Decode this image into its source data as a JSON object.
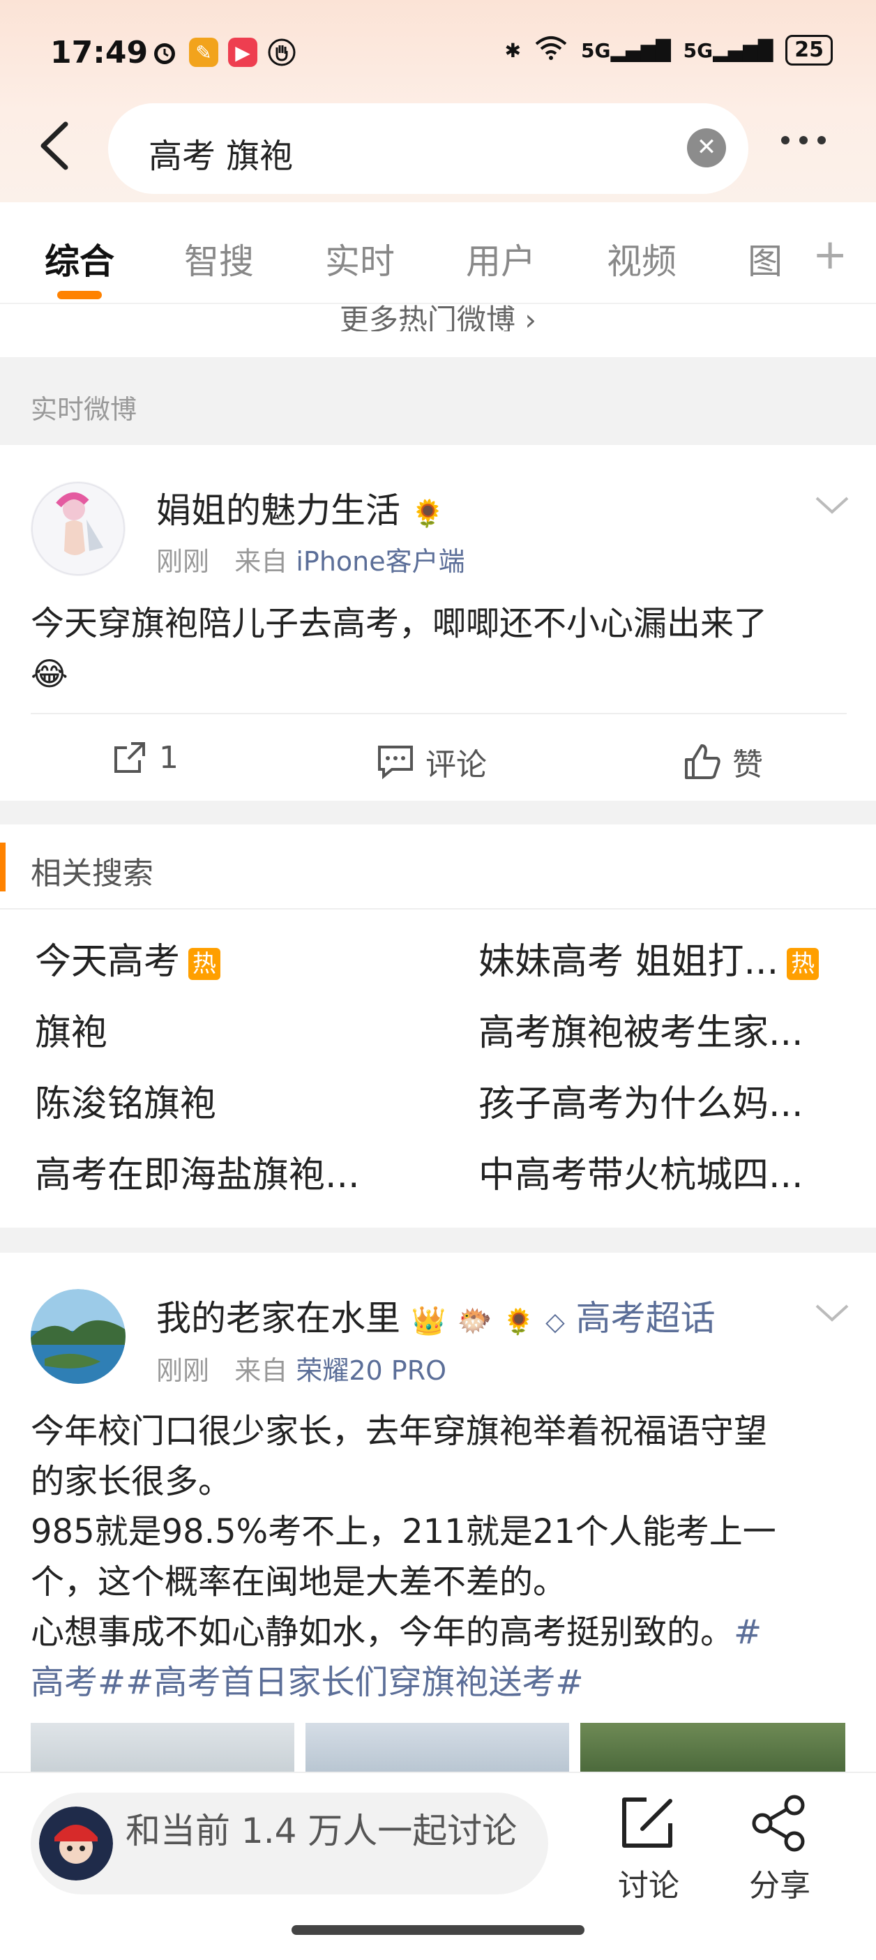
{
  "status_bar": {
    "time": "17:49",
    "network1": "5G",
    "network2": "5G",
    "battery": "25"
  },
  "search": {
    "query": "高考 旗袍"
  },
  "tabs": [
    {
      "label": "综合",
      "active": true
    },
    {
      "label": "智搜",
      "active": false
    },
    {
      "label": "实时",
      "active": false
    },
    {
      "label": "用户",
      "active": false
    },
    {
      "label": "视频",
      "active": false
    },
    {
      "label": "图",
      "active": false
    }
  ],
  "more_hot": "更多热门微博 ›",
  "section_realtime": "实时微博",
  "post1": {
    "username": "娟姐的魅力生活",
    "time": "刚刚",
    "from_label": "来自",
    "source": "iPhone客户端",
    "text": "今天穿旗袍陪儿子去高考，唧唧还不小心漏出来了",
    "repost_count": "1",
    "comment_label": "评论",
    "like_label": "赞"
  },
  "related": {
    "title": "相关搜索",
    "hot_badge": "热",
    "left": [
      "今天高考",
      "旗袍",
      "陈浚铭旗袍",
      "高考在即海盐旗袍..."
    ],
    "right": [
      "妹妹高考 姐姐打...",
      "高考旗袍被考生家...",
      "孩子高考为什么妈...",
      "中高考带火杭城四..."
    ]
  },
  "post2": {
    "username": "我的老家在水里",
    "supertopic": "高考超话",
    "time": "刚刚",
    "from_label": "来自",
    "source": "荣耀20 PRO",
    "line1": "今年校门口很少家长，去年穿旗袍举着祝福语守望",
    "line2": "的家长很多。",
    "line3": "985就是98.5%考不上，211就是21个人能考上一",
    "line4": "个，这个概率在闽地是大差不差的。",
    "line5": "心想事成不如心静如水，今年的高考挺别致的。",
    "hashtag_a": "#",
    "hashtag_b": "高考##高考首日家长们穿旗袍送考#"
  },
  "bottom": {
    "join_text": "和当前 1.4 万人一起讨论",
    "discuss_label": "讨论",
    "share_label": "分享"
  },
  "colors": {
    "accent": "#ff8200",
    "link": "#5b6e98",
    "hot_badge": "#ff9f00"
  }
}
